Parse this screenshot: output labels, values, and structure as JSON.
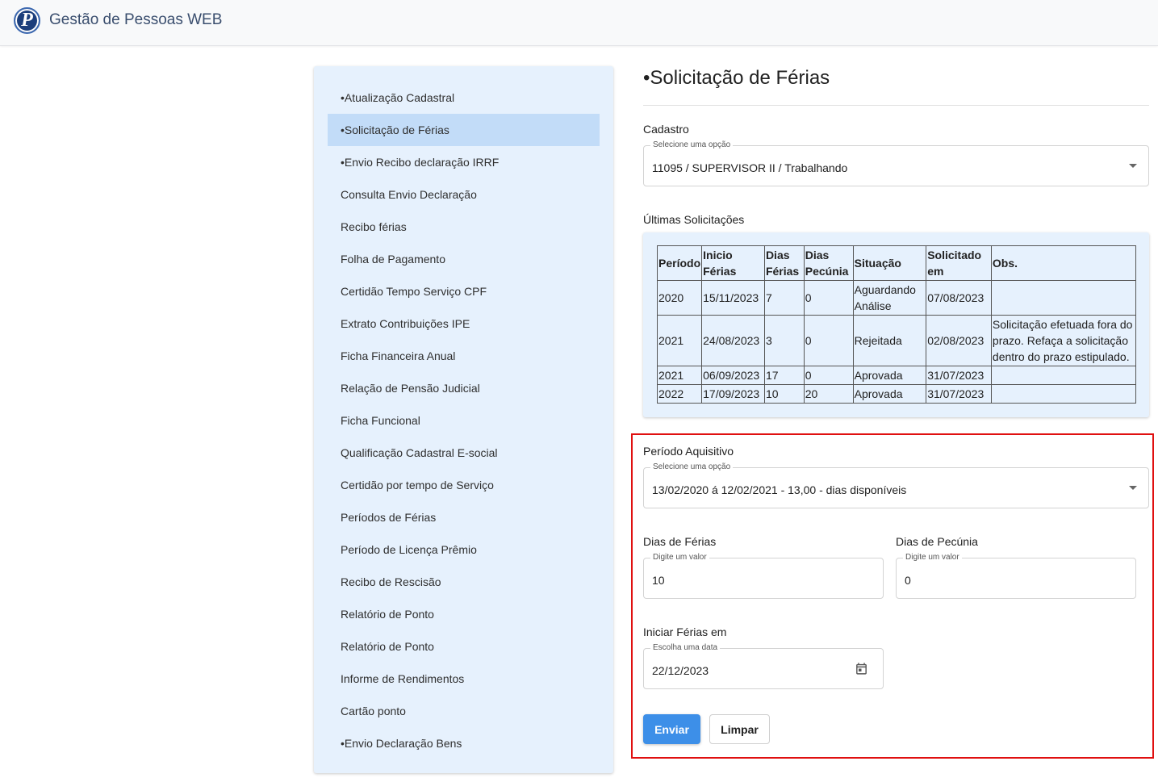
{
  "app": {
    "logo_letter": "P",
    "title": "Gestão de Pessoas WEB"
  },
  "menu": {
    "items": [
      "•Atualização Cadastral",
      "•Solicitação de Férias",
      "•Envio Recibo declaração IRRF",
      "Consulta Envio Declaração",
      "Recibo férias",
      "Folha de Pagamento",
      "Certidão Tempo Serviço CPF",
      "Extrato Contribuições IPE",
      "Ficha Financeira Anual",
      "Relação de Pensão Judicial",
      "Ficha Funcional",
      "Qualificação Cadastral E-social",
      "Certidão por tempo de Serviço",
      "Períodos de Férias",
      "Período de Licença Prêmio",
      "Recibo de Rescisão",
      "Relatório de Ponto",
      "Relatório de Ponto",
      "Informe de Rendimentos",
      "Cartão ponto",
      "•Envio Declaração Bens"
    ],
    "active_index": 1
  },
  "main": {
    "title": "•Solicitação de Férias",
    "cadastro": {
      "label": "Cadastro",
      "legend": "Selecione uma opção",
      "value": "11095 / SUPERVISOR II / Trabalhando"
    },
    "ultimas": {
      "label": "Últimas Solicitações",
      "headers": {
        "periodo": "Período",
        "inicio_l1": "Inicio",
        "inicio_l2": "Férias",
        "dias_ferias_l1": "Dias",
        "dias_ferias_l2": "Férias",
        "dias_pecunia_l1": "Dias",
        "dias_pecunia_l2": "Pecúnia",
        "situacao": "Situação",
        "solicitado_l1": "Solicitado",
        "solicitado_l2": "em",
        "obs": "Obs."
      },
      "rows": [
        {
          "periodo": "2020",
          "inicio": "15/11/2023",
          "dias_ferias": "7",
          "dias_pecunia": "0",
          "situacao_l1": "Aguardando",
          "situacao_l2": "Análise",
          "solicitado": "07/08/2023",
          "obs_l1": "",
          "obs_l2": "",
          "obs_l3": ""
        },
        {
          "periodo": "2021",
          "inicio": "24/08/2023",
          "dias_ferias": "3",
          "dias_pecunia": "0",
          "situacao": "Rejeitada",
          "solicitado": "02/08/2023",
          "obs_l1": "Solicitação efetuada fora do",
          "obs_l2": "prazo. Refaça a solicitação",
          "obs_l3": "dentro do prazo estipulado."
        },
        {
          "periodo": "2021",
          "inicio": "06/09/2023",
          "dias_ferias": "17",
          "dias_pecunia": "0",
          "situacao": "Aprovada",
          "solicitado": "31/07/2023",
          "obs": ""
        },
        {
          "periodo": "2022",
          "inicio": "17/09/2023",
          "dias_ferias": "10",
          "dias_pecunia": "20",
          "situacao": "Aprovada",
          "solicitado": "31/07/2023",
          "obs": ""
        }
      ]
    },
    "periodo_aquisitivo": {
      "label": "Período Aquisitivo",
      "legend": "Selecione uma opção",
      "value": "13/02/2020 á 12/02/2021 - 13,00 - dias disponíveis"
    },
    "dias_ferias": {
      "label": "Dias de Férias",
      "legend": "Digite um valor",
      "value": "10"
    },
    "dias_pecunia": {
      "label": "Dias de Pecúnia",
      "legend": "Digite um valor",
      "value": "0"
    },
    "iniciar": {
      "label": "Iniciar Férias em",
      "legend": "Escolha uma data",
      "value": "22/12/2023"
    },
    "buttons": {
      "enviar": "Enviar",
      "limpar": "Limpar"
    }
  },
  "colors": {
    "primary_button": "#3d8fe8",
    "highlight_border": "#e01010",
    "sidebar_bg": "#e6f1fd",
    "sidebar_active": "#c2dcf8",
    "status_rejected": "#e53935",
    "status_approved": "#2e7d32"
  },
  "icons": {
    "logo": "logo-icon",
    "dropdown": "chevron-down-icon",
    "calendar": "calendar-icon"
  }
}
